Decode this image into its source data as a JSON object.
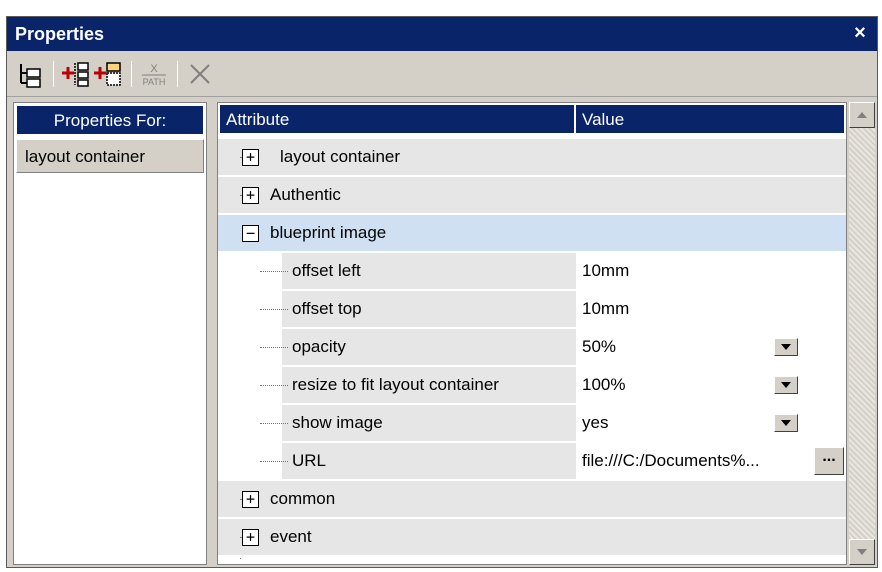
{
  "window": {
    "title": "Properties",
    "close_label": "×"
  },
  "toolbar": {
    "buttons": [
      {
        "icon": "tree-view-icon"
      },
      {
        "icon": "insert-child-property-icon"
      },
      {
        "icon": "insert-property-icon"
      },
      {
        "icon": "xpath-icon",
        "label_top": "X",
        "label_bottom": "PATH"
      },
      {
        "icon": "delete-icon"
      }
    ]
  },
  "left_pane": {
    "header": "Properties For:",
    "items": [
      "layout container"
    ]
  },
  "grid": {
    "columns": {
      "attribute": "Attribute",
      "value": "Value"
    },
    "groups": [
      {
        "label": "layout container",
        "expander": "+"
      },
      {
        "label": "Authentic",
        "expander": "+"
      },
      {
        "label": "blueprint image",
        "expander": "−"
      },
      {
        "label": "common",
        "expander": "+"
      },
      {
        "label": "event",
        "expander": "+"
      }
    ],
    "properties": [
      {
        "name": "offset left",
        "value": "10mm"
      },
      {
        "name": "offset top",
        "value": "10mm"
      },
      {
        "name": "opacity",
        "value": "50%"
      },
      {
        "name": "resize to fit layout container",
        "value": "100%"
      },
      {
        "name": "show image",
        "value": "yes"
      },
      {
        "name": "URL",
        "value": "file:///C:/Documents%...",
        "button": "..."
      }
    ]
  },
  "colors": {
    "title_bar": "#0a246a",
    "panel": "#d4d0c8",
    "selected_row": "#cfe0f3",
    "group_row": "#e6e6e6"
  }
}
